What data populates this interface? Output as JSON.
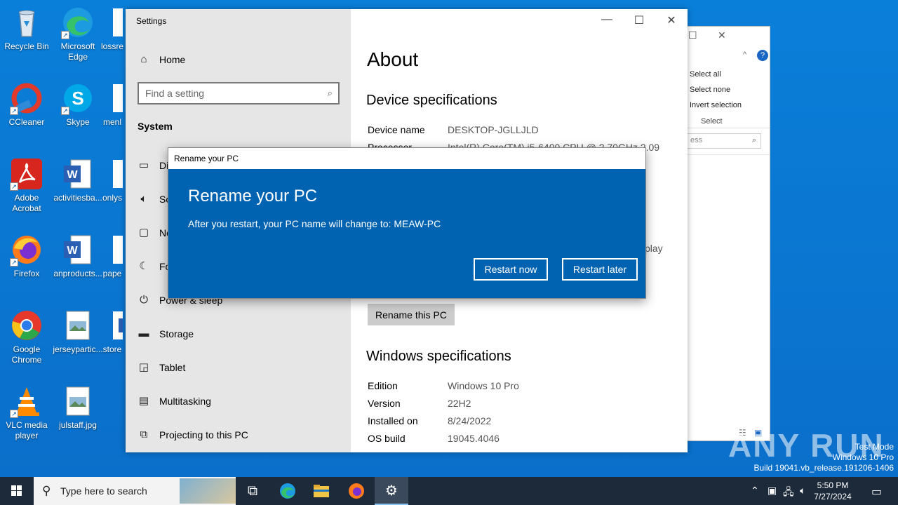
{
  "desktop": {
    "icons": [
      {
        "label": "Recycle Bin"
      },
      {
        "label": "Microsoft Edge"
      },
      {
        "label": "lossre"
      },
      {
        "label": "CCleaner"
      },
      {
        "label": "Skype"
      },
      {
        "label": "menl"
      },
      {
        "label": "Adobe Acrobat"
      },
      {
        "label": "activitiesba..."
      },
      {
        "label": "onlys"
      },
      {
        "label": "Firefox"
      },
      {
        "label": "anproducts..."
      },
      {
        "label": "pape"
      },
      {
        "label": "Google Chrome"
      },
      {
        "label": "jerseypartic..."
      },
      {
        "label": "store"
      },
      {
        "label": "VLC media player"
      },
      {
        "label": "julstaff.jpg"
      }
    ]
  },
  "explorer": {
    "commands": [
      "Select all",
      "Select none",
      "Invert selection"
    ],
    "group_label": "Select",
    "search_placeholder": "ess"
  },
  "settings": {
    "window_title": "Settings",
    "nav": {
      "home": "Home",
      "search_placeholder": "Find a setting",
      "section": "System",
      "items": [
        {
          "label": "Di",
          "icon": "display-icon"
        },
        {
          "label": "So",
          "icon": "sound-icon"
        },
        {
          "label": "No",
          "icon": "notifications-icon"
        },
        {
          "label": "Fo",
          "icon": "focus-assist-icon"
        },
        {
          "label": "Power & sleep",
          "icon": "power-icon"
        },
        {
          "label": "Storage",
          "icon": "storage-icon"
        },
        {
          "label": "Tablet",
          "icon": "tablet-icon"
        },
        {
          "label": "Multitasking",
          "icon": "multitasking-icon"
        },
        {
          "label": "Projecting to this PC",
          "icon": "projecting-icon"
        }
      ]
    },
    "content": {
      "title": "About",
      "device_heading": "Device specifications",
      "device_name_label": "Device name",
      "device_name_value": "DESKTOP-JGLLJLD",
      "processor_label": "Processor",
      "processor_value": "Intel(R) Core(TM) i5-6400 CPU @ 2.70GHz   2.09",
      "clipped_text": "play",
      "rename_button": "Rename this PC",
      "windows_heading": "Windows specifications",
      "windows_specs": [
        {
          "label": "Edition",
          "value": "Windows 10 Pro"
        },
        {
          "label": "Version",
          "value": "22H2"
        },
        {
          "label": "Installed on",
          "value": "8/24/2022"
        },
        {
          "label": "OS build",
          "value": "19045.4046"
        }
      ]
    }
  },
  "dialog": {
    "window_title": "Rename your PC",
    "heading": "Rename your PC",
    "message": "After you restart, your PC name will change to: MEAW-PC",
    "restart_now": "Restart now",
    "restart_later": "Restart later"
  },
  "watermark": {
    "line1": "Test Mode",
    "line2": "Windows 10 Pro",
    "line3": "Build 19041.vb_release.191206-1406",
    "brand": "ANY RUN"
  },
  "taskbar": {
    "search_placeholder": "Type here to search",
    "time": "5:50 PM",
    "date": "7/27/2024"
  }
}
